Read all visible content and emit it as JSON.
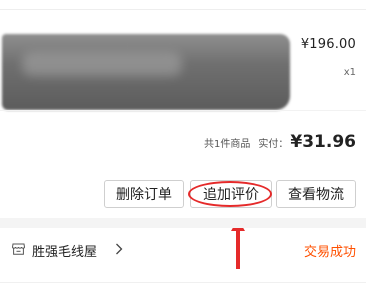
{
  "order": {
    "item": {
      "price": "¥196.00",
      "quantity": "x1"
    },
    "summary": {
      "count_text": "共1件商品",
      "paid_label": "实付：",
      "paid_amount": "¥31.96"
    },
    "actions": {
      "delete_label": "删除订单",
      "review_label": "追加评价",
      "logistics_label": "查看物流"
    },
    "store": {
      "icon": "store-icon",
      "name": "胜强毛线屋",
      "chevron_icon": "chevron-right-icon"
    },
    "status": "交易成功"
  },
  "colors": {
    "status": "#ff5000",
    "annotation": "#e52a2a",
    "border": "#cfcfcf",
    "band": "#f4f4f4"
  }
}
